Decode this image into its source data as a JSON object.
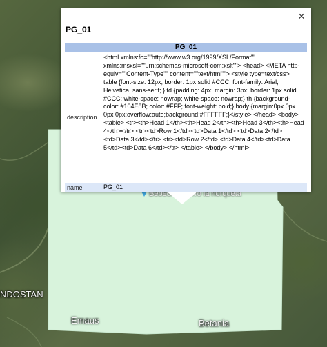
{
  "map": {
    "labels": {
      "left": "NDOSTAN",
      "bottom_left": "Emaus",
      "bottom_right": "Betania",
      "pin": "Bebedero cerro la horqueta"
    },
    "colors": {
      "polygon_fill": "#d8f3dc",
      "pin": "#3fa6e0"
    }
  },
  "balloon": {
    "title": "PG_01",
    "close_label": "×",
    "table_header": "PG_01",
    "rows": [
      {
        "key": "description",
        "value": "<html xmlns:fo=\"\"http://www.w3.org/1999/XSL/Format\"\" xmlns:msxsl=\"\"urn:schemas-microsoft-com:xslt\"\"> <head> <META http-equiv=\"\"Content-Type\"\" content=\"\"text/html\"\"> <style type=text/css> table {font-size: 12px; border: 1px solid #CCC; font-family: Arial, Helvetica, sans-serif; } td {padding: 4px; margin: 3px; border: 1px solid #CCC; white-space: nowrap; white-space: nowrap;} th {background-color: #104E8B; color: #FFF; font-weight: bold;} body {margin:0px 0px 0px 0px;overflow:auto;background:#FFFFFF;}</style> </head> <body> <table> <tr><th>Head 1</th><th>Head 2</th><th>Head 3</th><th>Head 4</th></tr> <tr><td>Row 1</td><td>Data 1</td> <td>Data 2</td><td>Data 3</td></tr> <tr><td>Row 2</td> <td>Data 4</td><td>Data 5</td><td>Data 6</td></tr> </table> </body> </html>"
      },
      {
        "key": "name",
        "value": "PG_01"
      }
    ]
  }
}
